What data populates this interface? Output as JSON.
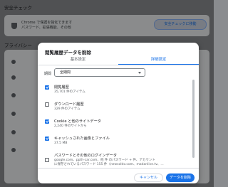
{
  "background": {
    "safety_check": {
      "title": "安全チェック",
      "line1": "Chrome で保護を強化できます",
      "line2": "パスワード、拡張機能、その他",
      "button": "安全チェックに移動"
    },
    "privacy_heading": "プライバシー"
  },
  "dialog": {
    "title": "閲覧履歴データを削除",
    "tabs": [
      "基本設定",
      "詳細設定"
    ],
    "period_label": "期間",
    "period_value": "全期間",
    "items": [
      {
        "title": "閲覧履歴",
        "sub1": "35,701 件のアイテム",
        "sub2": "",
        "checked": true
      },
      {
        "title": "ダウンロード履歴",
        "sub1": "329 件のアイテム",
        "sub2": "",
        "checked": false
      },
      {
        "title": "Cookie と他のサイトデータ",
        "sub1": "2,240 件のサイトから",
        "sub2": "",
        "checked": true
      },
      {
        "title": "キャッシュされた画像とファイル",
        "sub1": "37.5 MB",
        "sub2": "",
        "checked": true
      },
      {
        "title": "パスワードとその他のログインデータ",
        "sub1": "google.com、ppth-car.com、他 件 のパスワード + 件、アカウント",
        "sub2": "に保存されているパスワード 155 件（newsoldo.com、madanlive.tv、...",
        "checked": false
      }
    ],
    "cancel_label": "キャンセル",
    "delete_label": "データを削除",
    "accent_color": "#1a73e8"
  }
}
